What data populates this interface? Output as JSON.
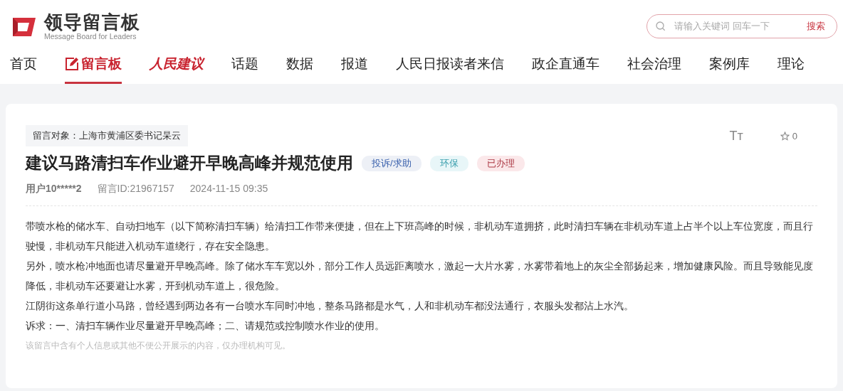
{
  "logo": {
    "title": "领导留言板",
    "subtitle": "Message Board for Leaders"
  },
  "search": {
    "placeholder": "请输入关键词 回车一下",
    "button": "搜索"
  },
  "nav": [
    {
      "label": "首页",
      "kind": "text",
      "selected": false
    },
    {
      "label": "留言板",
      "kind": "icon",
      "selected": true
    },
    {
      "label": "人民建议",
      "kind": "brand",
      "selected": false
    },
    {
      "label": "话题",
      "kind": "text",
      "selected": false
    },
    {
      "label": "数据",
      "kind": "text",
      "selected": false
    },
    {
      "label": "报道",
      "kind": "text",
      "selected": false
    },
    {
      "label": "人民日报读者来信",
      "kind": "text",
      "selected": false
    },
    {
      "label": "政企直通车",
      "kind": "text",
      "selected": false
    },
    {
      "label": "社会治理",
      "kind": "text",
      "selected": false
    },
    {
      "label": "案例库",
      "kind": "text",
      "selected": false
    },
    {
      "label": "理论",
      "kind": "text",
      "selected": false
    }
  ],
  "message": {
    "target": "留言对象：上海市黄浦区委书记杲云",
    "font_size_toggle": "Tт",
    "favorites": "0",
    "title": "建议马路清扫车作业避开早晚高峰并规范使用",
    "tags": [
      {
        "label": "投诉/求助",
        "color": "#edf0f6"
      },
      {
        "label": "环保",
        "color": "#e8f6f8"
      },
      {
        "label": "已办理",
        "color": "#fbe8ea"
      }
    ],
    "user": "用户10*****2",
    "id": "留言ID:21967157",
    "time": "2024-11-15 09:35",
    "paragraphs": [
      "带喷水枪的储水车、自动扫地车（以下简称清扫车辆）给清扫工作带来便捷，但在上下班高峰的时候，非机动车道拥挤，此时清扫车辆在非机动车道上占半个以上车位宽度，而且行驶慢，非机动车只能进入机动车道绕行，存在安全隐患。",
      "另外，喷水枪冲地面也请尽量避开早晚高峰。除了储水车车宽以外，部分工作人员远距离喷水，激起一大片水雾，水雾带着地上的灰尘全部扬起来，增加健康风险。而且导致能见度降低，非机动车还要避让水雾，开到机动车道上，很危险。",
      "江阴街这条单行道小马路，曾经遇到两边各有一台喷水车同时冲地，整条马路都是水气，人和非机动车都没法通行，衣服头发都沾上水汽。",
      "诉求：一、清扫车辆作业尽量避开早晚高峰；二、请规范或控制喷水作业的使用。"
    ],
    "note": "该留言中含有个人信息或其他不便公开展示的内容，仅办理机构可见。"
  }
}
